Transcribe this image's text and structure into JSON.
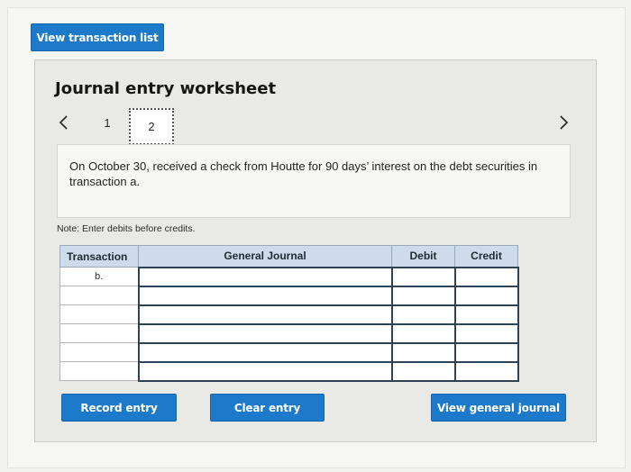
{
  "top": {
    "view_transaction_list": "View transaction list"
  },
  "worksheet": {
    "title": "Journal entry worksheet",
    "pager": {
      "prev_icon": "chevron-left-icon",
      "next_icon": "chevron-right-icon",
      "pages": [
        "1",
        "2"
      ],
      "current": "2"
    },
    "question": "On October 30, received a check from Houtte for 90 days’ interest on the debt securities in transaction a.",
    "note": "Note: Enter debits before credits.",
    "table": {
      "headers": [
        "Transaction",
        "General Journal",
        "Debit",
        "Credit"
      ],
      "rows": [
        {
          "transaction": "b.",
          "account": "",
          "debit": "",
          "credit": ""
        },
        {
          "transaction": "",
          "account": "",
          "debit": "",
          "credit": ""
        },
        {
          "transaction": "",
          "account": "",
          "debit": "",
          "credit": ""
        },
        {
          "transaction": "",
          "account": "",
          "debit": "",
          "credit": ""
        },
        {
          "transaction": "",
          "account": "",
          "debit": "",
          "credit": ""
        },
        {
          "transaction": "",
          "account": "",
          "debit": "",
          "credit": ""
        }
      ]
    },
    "buttons": {
      "record": "Record entry",
      "clear": "Clear entry",
      "view_journal": "View general journal"
    }
  },
  "colors": {
    "button": "#1d7acb",
    "header": "#cfdbea",
    "panel": "#e9e9e6"
  }
}
